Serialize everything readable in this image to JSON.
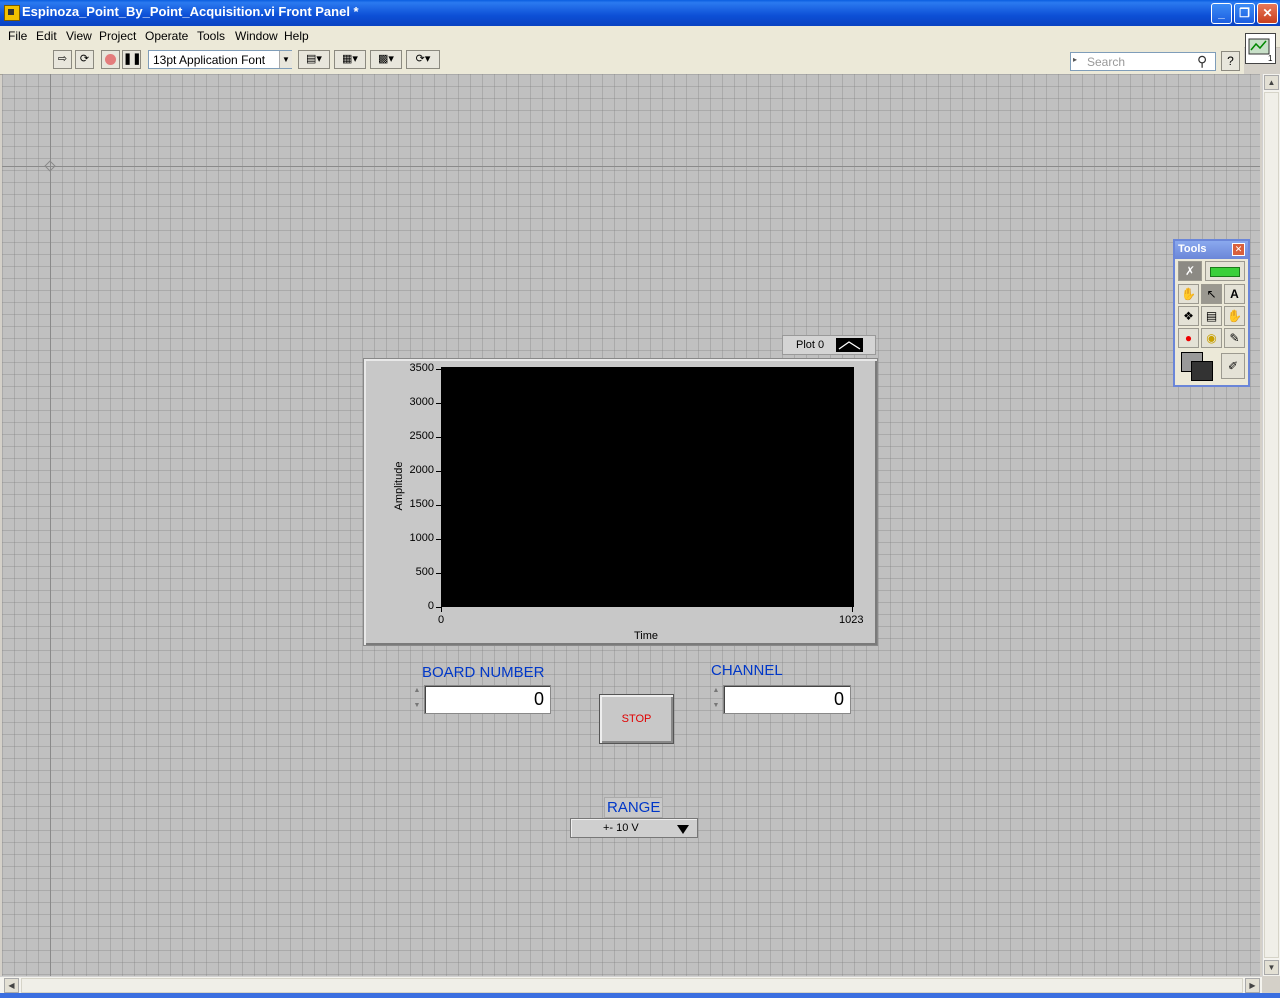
{
  "window": {
    "title": "Espinoza_Point_By_Point_Acquisition.vi Front Panel *",
    "minimize": "_",
    "maximize": "❐",
    "close": "✕"
  },
  "menu": [
    "File",
    "Edit",
    "View",
    "Project",
    "Operate",
    "Tools",
    "Window",
    "Help"
  ],
  "toolbar": {
    "font": "13pt Application Font",
    "search_placeholder": "Search",
    "help": "?"
  },
  "graph": {
    "legend": "Plot 0",
    "y_axis_label": "Amplitude",
    "x_axis_label": "Time"
  },
  "chart_data": {
    "type": "line",
    "series": [
      {
        "name": "Plot 0",
        "values": []
      }
    ],
    "xlabel": "Time",
    "ylabel": "Amplitude",
    "xlim": [
      0,
      1023
    ],
    "ylim": [
      0,
      3500
    ],
    "yticks": [
      "3500",
      "3000",
      "2500",
      "2000",
      "1500",
      "1000",
      "500",
      "0"
    ],
    "xticks": [
      "0",
      "1023"
    ],
    "plot_background": "#000000"
  },
  "controls": {
    "board_number": {
      "label": "BOARD NUMBER",
      "value": "0"
    },
    "channel": {
      "label": "CHANNEL",
      "value": "0"
    },
    "stop": {
      "label": "STOP"
    },
    "range": {
      "label": "RANGE",
      "value": "+- 10 V"
    }
  },
  "tools_palette": {
    "title": "Tools",
    "close": "✕"
  },
  "colors": {
    "label_blue": "#0037c8",
    "stop_red": "#e00000",
    "panel_gray": "#c0c0c0"
  }
}
